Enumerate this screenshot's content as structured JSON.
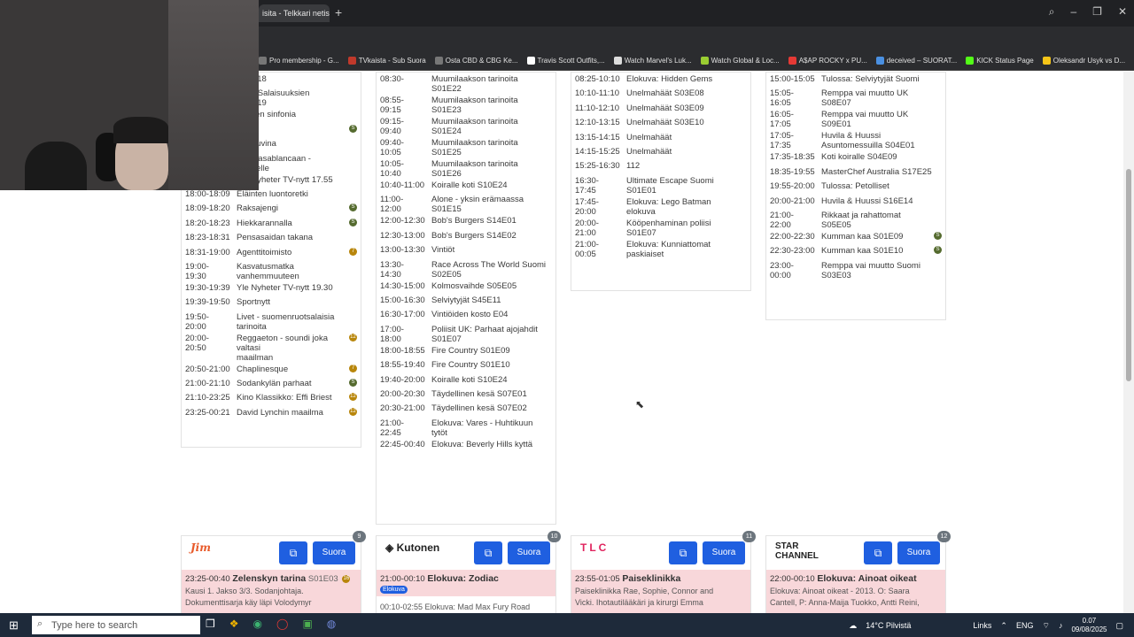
{
  "browser": {
    "tab_title": "isita - Telkkari netissä",
    "new_tab_icon": "+",
    "bookmarks": [
      "Pro membership - G...",
      "TVkaista - Sub Suora",
      "Osta CBD & CBG Ke...",
      "Travis Scott Outfits,...",
      "Watch Marvel's Luk...",
      "Watch Global & Loc...",
      "A$AP ROCKY x PU...",
      "deceived – SUORAT...",
      "KICK Status Page",
      "Oleksandr Usyk vs D..."
    ]
  },
  "columns": [
    {
      "rows": [
        {
          "time": "",
          "name": "S04E18"
        },
        {
          "time": "",
          "name": "esa - Salaisuuksien\nS04E19"
        },
        {
          "time": "",
          "name": "eräinen sinfonia"
        },
        {
          "time": "",
          "name": "olle",
          "badge": "S"
        },
        {
          "time": "",
          "name": "kka kuvina"
        },
        {
          "time": "",
          "name": "istä Casablancaan -\nläkkeelle"
        },
        {
          "time": "17:55-18:00",
          "name": "Yle Nyheter TV-nytt 17.55"
        },
        {
          "time": "18:00-18:09",
          "name": "Eläinten luontoretki"
        },
        {
          "time": "18:09-18:20",
          "name": "Raksajengi",
          "badge": "S"
        },
        {
          "time": "18:20-18:23",
          "name": "Hiekkarannalla",
          "badge": "S"
        },
        {
          "time": "18:23-18:31",
          "name": "Pensasaidan takana"
        },
        {
          "time": "18:31-19:00",
          "name": "Agenttitoimisto",
          "badge": "7"
        },
        {
          "time": "19:00-\n19:30",
          "name": "Kasvatusmatka\nvanhemmuuteen"
        },
        {
          "time": "19:30-19:39",
          "name": "Yle Nyheter TV-nytt 19.30"
        },
        {
          "time": "19:39-19:50",
          "name": "Sportnytt"
        },
        {
          "time": "19:50-\n20:00",
          "name": "Livet - suomenruotsalaisia\ntarinoita"
        },
        {
          "time": "20:00-\n20:50",
          "name": "Reggaeton - soundi joka valtasi\nmaailman",
          "badge": "12"
        },
        {
          "time": "20:50-21:00",
          "name": "Chaplinesque",
          "badge": "7"
        },
        {
          "time": "21:00-21:10",
          "name": "Sodankylän parhaat",
          "badge": "S"
        },
        {
          "time": "21:10-23:25",
          "name": "Kino Klassikko: Effi Briest",
          "badge": "12"
        },
        {
          "time": "23:25-00:21",
          "name": "David Lynchin maailma",
          "badge": "12"
        }
      ]
    },
    {
      "rows": [
        {
          "time": "08:30-",
          "name": "Muumilaakson tarinoita\nS01E22"
        },
        {
          "time": "08:55-\n09:15",
          "name": "Muumilaakson tarinoita\nS01E23"
        },
        {
          "time": "09:15-\n09:40",
          "name": "Muumilaakson tarinoita\nS01E24"
        },
        {
          "time": "09:40-\n10:05",
          "name": "Muumilaakson tarinoita\nS01E25"
        },
        {
          "time": "10:05-\n10:40",
          "name": "Muumilaakson tarinoita\nS01E26"
        },
        {
          "time": "10:40-11:00",
          "name": "Koiralle koti S10E24"
        },
        {
          "time": "11:00-\n12:00",
          "name": "Alone - yksin erämaassa\nS01E15"
        },
        {
          "time": "12:00-12:30",
          "name": "Bob's Burgers S14E01"
        },
        {
          "time": "12:30-13:00",
          "name": "Bob's Burgers S14E02"
        },
        {
          "time": "13:00-13:30",
          "name": "Vintiöt"
        },
        {
          "time": "13:30-\n14:30",
          "name": "Race Across The World Suomi\nS02E05"
        },
        {
          "time": "14:30-15:00",
          "name": "Kolmosvaihde S05E05"
        },
        {
          "time": "15:00-16:30",
          "name": "Selviytyjät S45E11"
        },
        {
          "time": "16:30-17:00",
          "name": "Vintiöiden kosto E04"
        },
        {
          "time": "17:00-\n18:00",
          "name": "Poliisit UK: Parhaat ajojahdit\nS01E07"
        },
        {
          "time": "18:00-18:55",
          "name": "Fire Country S01E09"
        },
        {
          "time": "18:55-19:40",
          "name": "Fire Country S01E10"
        },
        {
          "time": "19:40-20:00",
          "name": "Koiralle koti S10E24"
        },
        {
          "time": "20:00-20:30",
          "name": "Täydellinen kesä S07E01"
        },
        {
          "time": "20:30-21:00",
          "name": "Täydellinen kesä S07E02"
        },
        {
          "time": "21:00-\n22:45",
          "name": "Elokuva: Vares - Huhtikuun\ntytöt"
        },
        {
          "time": "22:45-00:40",
          "name": "Elokuva: Beverly Hills kyttä"
        }
      ]
    },
    {
      "rows": [
        {
          "time": "08:25-10:10",
          "name": "Elokuva: Hidden Gems"
        },
        {
          "time": "10:10-11:10",
          "name": "Unelmahäät S03E08"
        },
        {
          "time": "11:10-12:10",
          "name": "Unelmahäät S03E09"
        },
        {
          "time": "12:10-13:15",
          "name": "Unelmahäät S03E10"
        },
        {
          "time": "13:15-14:15",
          "name": "Unelmahäät"
        },
        {
          "time": "14:15-15:25",
          "name": "Unelmahäät"
        },
        {
          "time": "15:25-16:30",
          "name": "112"
        },
        {
          "time": "16:30-\n17:45",
          "name": "Ultimate Escape Suomi\nS01E01"
        },
        {
          "time": "17:45-\n20:00",
          "name": "Elokuva: Lego Batman\nelokuva"
        },
        {
          "time": "20:00-\n21:00",
          "name": "Kööpenhaminan poliisi\nS01E07"
        },
        {
          "time": "21:00-\n00:05",
          "name": "Elokuva: Kunniattomat\npaskiaiset"
        }
      ]
    },
    {
      "rows": [
        {
          "time": "15:00-15:05",
          "name": "Tulossa: Selviytyjät Suomi"
        },
        {
          "time": "15:05-\n16:05",
          "name": "Remppa vai muutto UK\nS08E07"
        },
        {
          "time": "16:05-\n17:05",
          "name": "Remppa vai muutto UK\nS09E01"
        },
        {
          "time": "17:05-\n17:35",
          "name": "Huvila & Huussi\nAsuntomessuilla S04E01"
        },
        {
          "time": "17:35-18:35",
          "name": "Koti koiralle S04E09"
        },
        {
          "time": "18:35-19:55",
          "name": "MasterChef Australia S17E25"
        },
        {
          "time": "19:55-20:00",
          "name": "Tulossa: Petolliset"
        },
        {
          "time": "20:00-21:00",
          "name": "Huvila & Huussi S16E14"
        },
        {
          "time": "21:00-\n22:00",
          "name": "Rikkaat ja rahattomat\nS05E05"
        },
        {
          "time": "22:00-22:30",
          "name": "Kumman kaa S01E09",
          "badge": "S"
        },
        {
          "time": "22:30-23:00",
          "name": "Kumman kaa S01E10",
          "badge": "S"
        },
        {
          "time": "23:00-\n00:00",
          "name": "Remppa vai muutto Suomi\nS03E03"
        }
      ]
    }
  ],
  "cards": [
    {
      "logo": "Jim",
      "number": "9",
      "cast_icon": "cast-icon",
      "live_label": "Suora",
      "now_time": "23:25-00:40",
      "now_title": "Zelenskyn tarina",
      "now_ep": "S01E03",
      "badge": "16",
      "desc": "Kausi 1. Jakso 3/3. Sodanjohtaja.\nDokumenttisarja käy läpi Volodymyr"
    },
    {
      "logo": "Kutonen",
      "number": "10",
      "cast_icon": "cast-icon",
      "live_label": "Suora",
      "now_time": "21:00-00:10",
      "now_title": "Elokuva: Zodiac",
      "tag": "Elokuva",
      "desc": "00:10-02:55  Elokuva: Mad Max Fury Road"
    },
    {
      "logo": "TLC",
      "number": "11",
      "cast_icon": "cast-icon",
      "live_label": "Suora",
      "now_time": "23:55-01:05",
      "now_title": "Paiseklinikka",
      "desc": "Paiseklinikka Rae, Sophie, Connor and\nVicki. Ihotautilääkäri ja kirurgi Emma"
    },
    {
      "logo": "STAR CHANNEL",
      "number": "12",
      "cast_icon": "cast-icon",
      "live_label": "Suora",
      "now_time": "22:00-00:10",
      "now_title": "Elokuva: Ainoat oikeat",
      "desc": "Elokuva: Ainoat oikeat - 2013. O: Saara\nCantell, P: Anna-Maija Tuokko, Antti Reini,"
    }
  ],
  "taskbar": {
    "search_placeholder": "Type here to search",
    "weather": "14°C Pilvistä",
    "links": "Links",
    "lang": "ENG",
    "time": "0.07",
    "date": "09/08/2025"
  }
}
